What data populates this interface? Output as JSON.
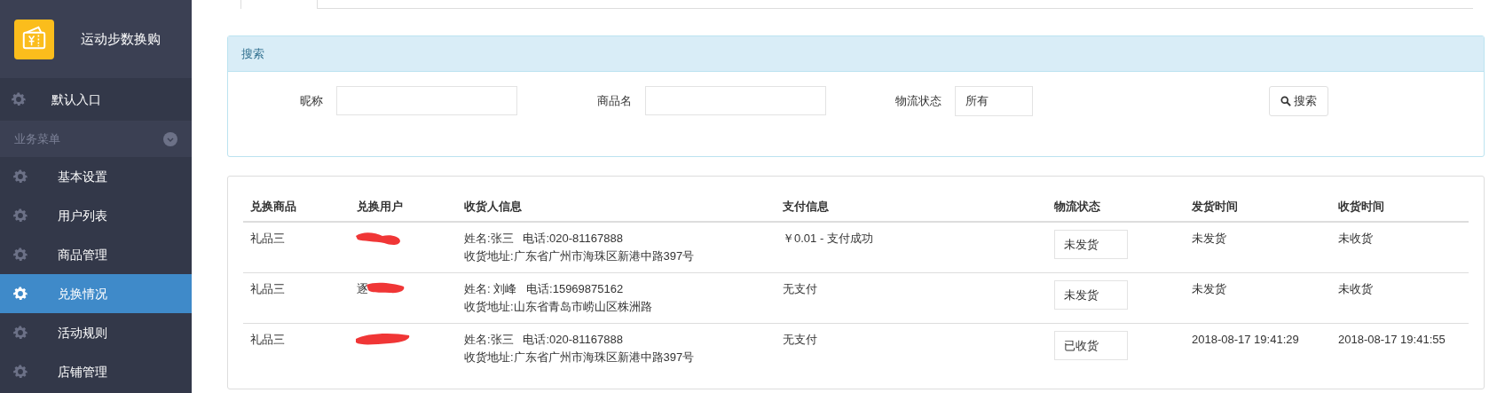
{
  "app": {
    "title": "运动步数换购"
  },
  "sidebar": {
    "entry": "默认入口",
    "section": {
      "label": "业务菜单",
      "expanded": true
    },
    "items": [
      {
        "label": "基本设置",
        "selected": false
      },
      {
        "label": "用户列表",
        "selected": false
      },
      {
        "label": "商品管理",
        "selected": false
      },
      {
        "label": "兑换情况",
        "selected": true
      },
      {
        "label": "活动规则",
        "selected": false
      },
      {
        "label": "店铺管理",
        "selected": false
      }
    ]
  },
  "search_panel": {
    "title": "搜索",
    "fields": [
      {
        "label": "昵称"
      },
      {
        "label": "商品名"
      }
    ],
    "status_label": "物流状态",
    "status_value": "所有",
    "button": "搜索"
  },
  "table": {
    "columns": [
      "兑换商品",
      "兑换用户",
      "收货人信息",
      "支付信息",
      "物流状态",
      "发货时间",
      "收货时间"
    ],
    "rows": [
      {
        "product": "礼品三",
        "user": "",
        "redacted": true,
        "receiver": "姓名:张三   电话:020-81167888",
        "address": "收货地址:广东省广州市海珠区新港中路397号",
        "payment": "￥0.01 - 支付成功",
        "status": "未发货",
        "ship_time": "未发货",
        "receive_time": "未收货"
      },
      {
        "product": "礼品三",
        "user": "逐",
        "redacted": true,
        "receiver": "姓名: 刘峰   电话:15969875162",
        "address": "收货地址:山东省青岛市崂山区株洲路",
        "payment": "无支付",
        "status": "未发货",
        "ship_time": "未发货",
        "receive_time": "未收货"
      },
      {
        "product": "礼品三",
        "user": "",
        "redacted": true,
        "receiver": "姓名:张三   电话:020-81167888",
        "address": "收货地址:广东省广州市海珠区新港中路397号",
        "payment": "无支付",
        "status": "已收货",
        "ship_time": "2018-08-17 19:41:29",
        "receive_time": "2018-08-17 19:41:55"
      }
    ]
  }
}
